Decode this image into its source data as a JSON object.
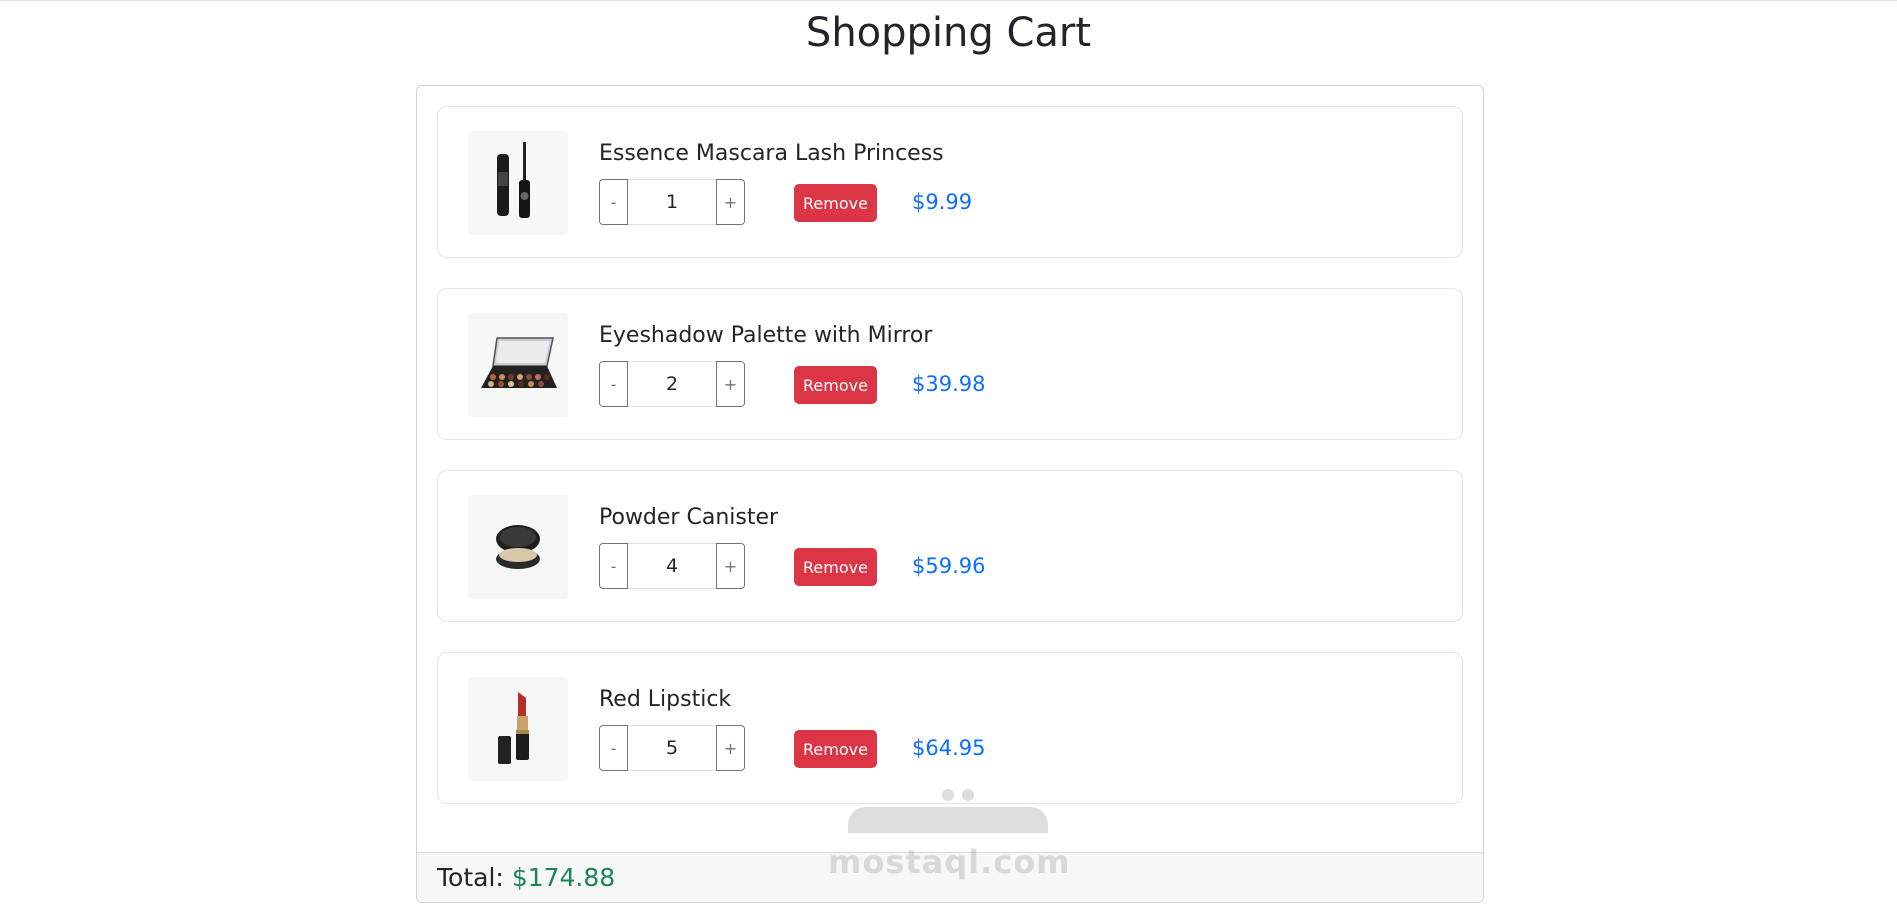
{
  "page": {
    "title": "Shopping Cart"
  },
  "cart": {
    "items": [
      {
        "name": "Essence Mascara Lash Princess",
        "quantity": "1",
        "price": "$9.99",
        "remove_label": "Remove",
        "minus_label": "-",
        "plus_label": "+",
        "image_icon": "mascara-image"
      },
      {
        "name": "Eyeshadow Palette with Mirror",
        "quantity": "2",
        "price": "$39.98",
        "remove_label": "Remove",
        "minus_label": "-",
        "plus_label": "+",
        "image_icon": "eyeshadow-palette-image"
      },
      {
        "name": "Powder Canister",
        "quantity": "4",
        "price": "$59.96",
        "remove_label": "Remove",
        "minus_label": "-",
        "plus_label": "+",
        "image_icon": "powder-canister-image"
      },
      {
        "name": "Red Lipstick",
        "quantity": "5",
        "price": "$64.95",
        "remove_label": "Remove",
        "minus_label": "-",
        "plus_label": "+",
        "image_icon": "lipstick-image"
      }
    ],
    "total_label": "Total:",
    "total_value": "$174.88"
  },
  "watermark": {
    "text": "mostaql.com"
  },
  "colors": {
    "remove": "#dc3545",
    "price": "#0d6efd",
    "total": "#198754"
  }
}
